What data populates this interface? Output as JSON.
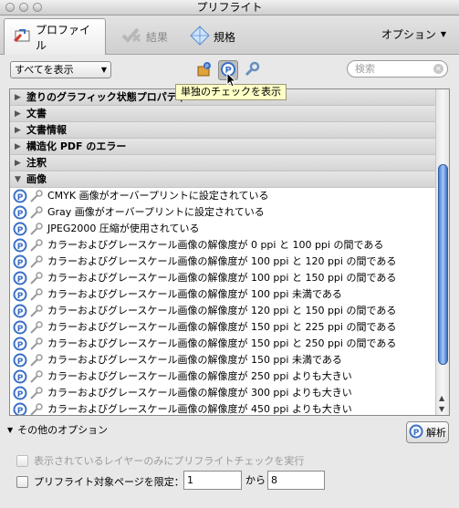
{
  "window": {
    "title": "プリフライト"
  },
  "toolbar": {
    "tabs": [
      {
        "label": "プロファイル",
        "icon": "profile-icon",
        "active": true
      },
      {
        "label": "結果",
        "icon": "results-icon",
        "active": false
      },
      {
        "label": "規格",
        "icon": "standards-icon",
        "active": false
      }
    ],
    "options_label": "オプション"
  },
  "filter": {
    "selected": "すべてを表示"
  },
  "search": {
    "placeholder": "検索"
  },
  "tooltip": "単独のチェックを表示",
  "list": {
    "groups": [
      "塗りのグラフィック状態プロパティ",
      "文書",
      "文書情報",
      "構造化 PDF のエラー",
      "注釈",
      "画像"
    ],
    "items": [
      "CMYK 画像がオーバープリントに設定されている",
      "Gray 画像がオーバープリントに設定されている",
      "JPEG2000 圧縮が使用されている",
      "カラーおよびグレースケール画像の解像度が 0 ppi と 100 ppi の間である",
      "カラーおよびグレースケール画像の解像度が 100 ppi と 120 ppi の間である",
      "カラーおよびグレースケール画像の解像度が 100 ppi と 150 ppi の間である",
      "カラーおよびグレースケール画像の解像度が 100 ppi 未満である",
      "カラーおよびグレースケール画像の解像度が 120 ppi と 150 ppi の間である",
      "カラーおよびグレースケール画像の解像度が 150 ppi と 225 ppi の間である",
      "カラーおよびグレースケール画像の解像度が 150 ppi と 250 ppi の間である",
      "カラーおよびグレースケール画像の解像度が 150 ppi 未満である",
      "カラーおよびグレースケール画像の解像度が 250 ppi よりも大きい",
      "カラーおよびグレースケール画像の解像度が 300 ppi よりも大きい",
      "カラーおよびグレースケール画像の解像度が 450 ppi よりも大きい"
    ]
  },
  "more_options": "その他のオプション",
  "analyze_label": "解析",
  "check_visible_layers": "表示されているレイヤーのみにプリフライトチェックを実行",
  "check_page_range": "プリフライト対象ページを限定：",
  "page_from": "1",
  "page_to_label": "から",
  "page_to": "8",
  "colors": {
    "accent": "#3b6fc4",
    "tooltip": "#ffffc6"
  }
}
